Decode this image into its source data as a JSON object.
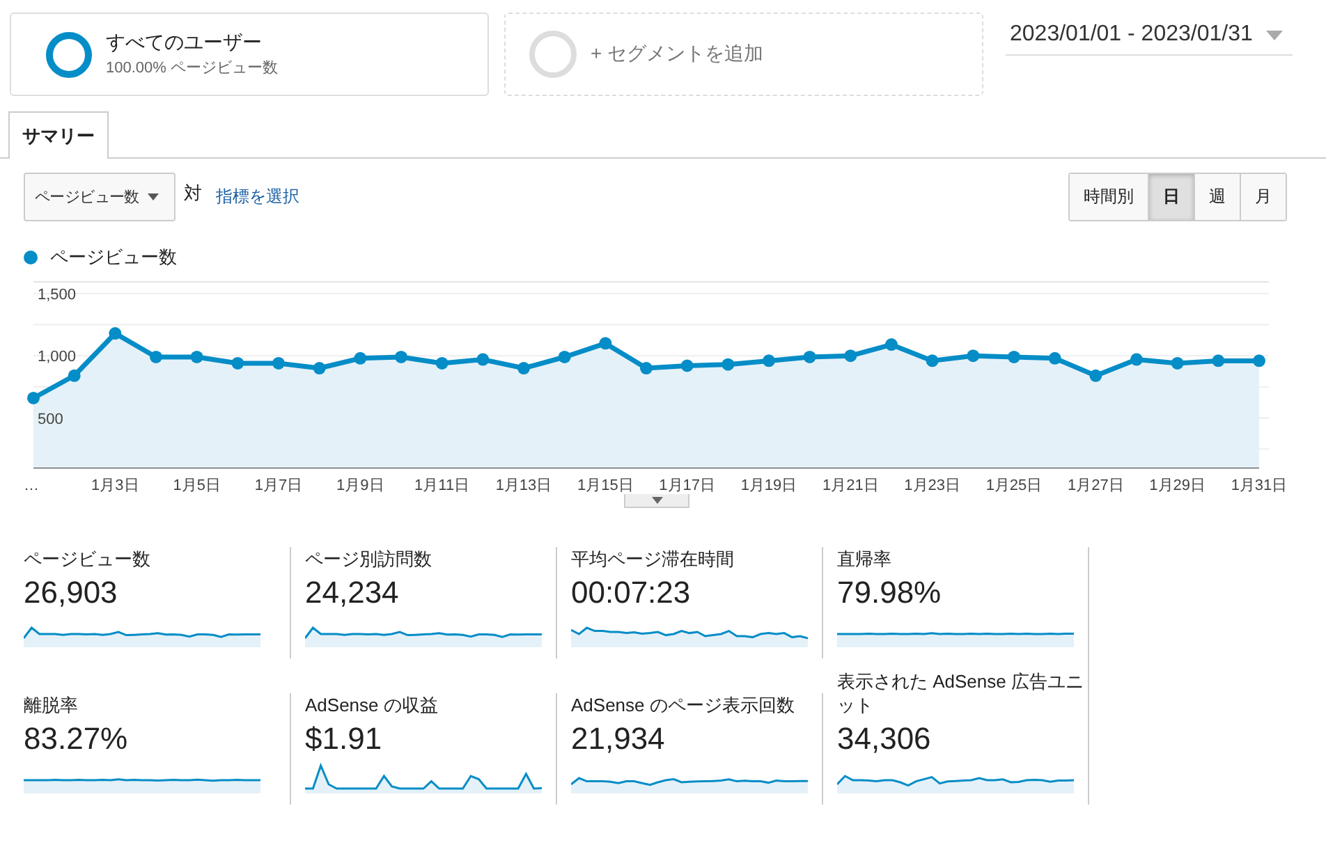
{
  "segments": [
    {
      "kind": "active",
      "name": "すべてのユーザー",
      "detail": "100.00% ページビュー数"
    },
    {
      "kind": "add",
      "name": "+ セグメントを追加"
    }
  ],
  "date_range": "2023/01/01 - 2023/01/31",
  "tabs": [
    {
      "label": "サマリー",
      "selected": true
    }
  ],
  "metric_select": {
    "value": "ページビュー数"
  },
  "versus": "対",
  "choose_metric_link": "指標を選択",
  "granularity": [
    {
      "label": "時間別",
      "selected": false
    },
    {
      "label": "日",
      "selected": true
    },
    {
      "label": "週",
      "selected": false
    },
    {
      "label": "月",
      "selected": false
    }
  ],
  "chart": {
    "chart_data": {
      "type": "area",
      "categories": [
        "…",
        null,
        "1月3日",
        null,
        "1月5日",
        null,
        "1月7日",
        null,
        "1月9日",
        null,
        "1月11日",
        null,
        "1月13日",
        null,
        "1月15日",
        null,
        "1月17日",
        null,
        "1月19日",
        null,
        "1月21日",
        null,
        "1月23日",
        null,
        "1月25日",
        null,
        "1月27日",
        null,
        "1月29日",
        null,
        "1月31日"
      ],
      "series": [
        {
          "name": "ページビュー数",
          "color": "#058dc7",
          "values": [
            660,
            840,
            1180,
            990,
            990,
            940,
            940,
            900,
            980,
            990,
            940,
            970,
            900,
            990,
            1100,
            900,
            920,
            930,
            960,
            990,
            1000,
            1090,
            960,
            1000,
            990,
            980,
            840,
            970,
            940,
            960,
            960
          ]
        }
      ],
      "grid": true,
      "ylim": [
        100,
        1600
      ],
      "yticks": [
        {
          "value": 500,
          "label": "500"
        },
        {
          "value": 1000,
          "label": "1,000"
        },
        {
          "value": 1500,
          "label": "1,500"
        }
      ]
    }
  },
  "metrics": [
    {
      "label": "ページビュー数",
      "value": "26,903"
    },
    {
      "label": "ページ別訪問数",
      "value": "24,234"
    },
    {
      "label": "平均ページ滞在時間",
      "value": "00:07:23"
    },
    {
      "label": "直帰率",
      "value": "79.98%"
    },
    {
      "label": "離脱率",
      "value": "83.27%"
    },
    {
      "label": "AdSense の収益",
      "value": "$1.91"
    },
    {
      "label": "AdSense のページ表示回数",
      "value": "21,934"
    },
    {
      "label": "表示された AdSense 広告ユニット",
      "value": "34,306"
    }
  ]
}
